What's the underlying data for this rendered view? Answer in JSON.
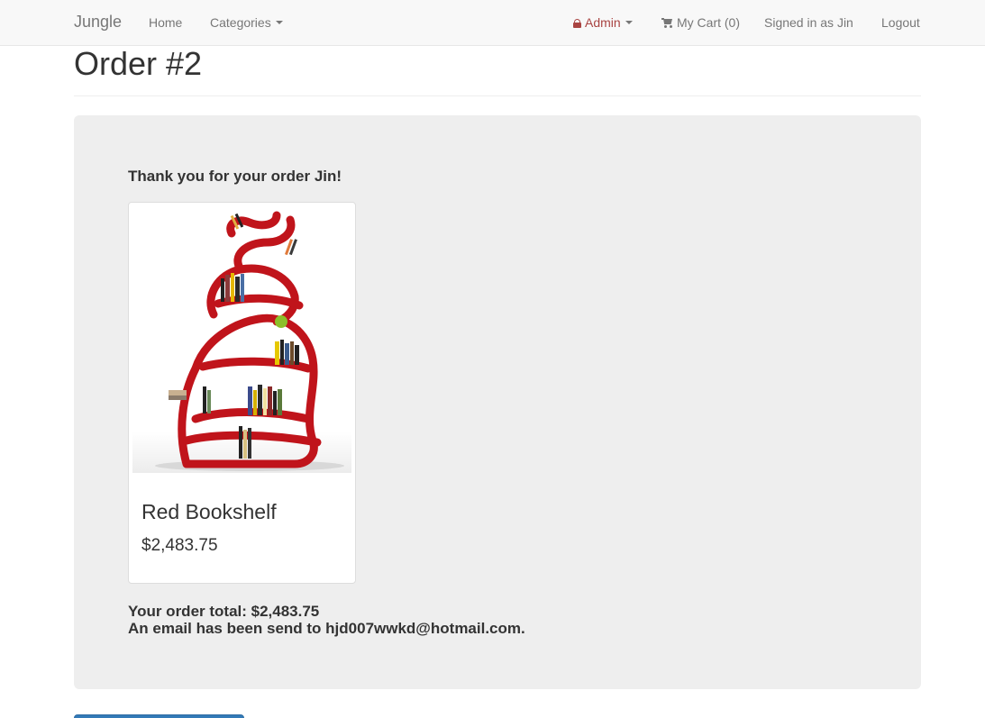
{
  "navbar": {
    "brand": "Jungle",
    "home": "Home",
    "categories": "Categories",
    "admin": "Admin",
    "cart": "My Cart (0)",
    "signed_in": "Signed in as Jin",
    "logout": "Logout",
    "icons": {
      "admin": "lock-icon",
      "cart": "shopping-cart-icon",
      "dropdown": "caret-down-icon"
    }
  },
  "page": {
    "title": "Order #2"
  },
  "order": {
    "thanks": "Thank you for your order Jin!",
    "items": [
      {
        "name": "Red Bookshelf",
        "price": "$2,483.75"
      }
    ],
    "total": "Your order total: $2,483.75",
    "email_note": "An email has been send to hjd007wwkd@hotmail.com."
  },
  "colors": {
    "navbar_bg": "#f8f8f8",
    "panel_bg": "#eeeeee",
    "admin_accent": "#a94442",
    "button_primary": "#337ab7"
  }
}
